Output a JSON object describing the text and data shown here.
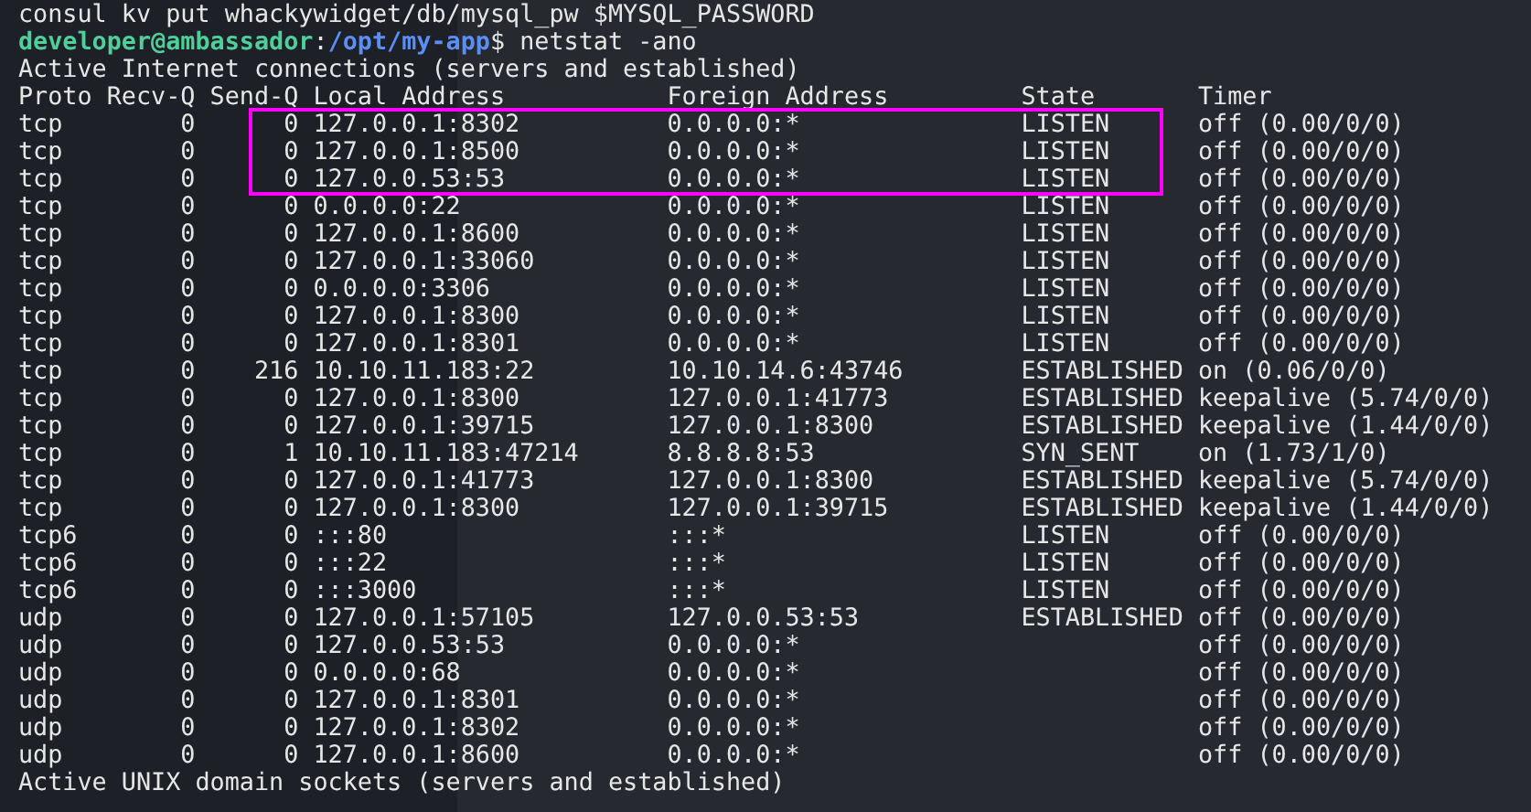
{
  "terminal": {
    "previous_command": "consul kv put whackywidget/db/mysql_pw $MYSQL_PASSWORD",
    "prompt": {
      "user_host": "developer@ambassador",
      "separator": ":",
      "path": "/opt/my-app",
      "symbol": "$",
      "command": "netstat -ano"
    },
    "section_title": "Active Internet connections (servers and established)",
    "table": [
      {
        "kind": "header",
        "highlighted": false,
        "cells": [
          "Proto",
          "Recv-Q",
          "Send-Q",
          "Local Address",
          "Foreign Address",
          "State",
          "Timer"
        ]
      },
      {
        "kind": "row",
        "highlighted": true,
        "cells": [
          "tcp",
          "0",
          "0",
          "127.0.0.1:8302",
          "0.0.0.0:*",
          "LISTEN",
          "off (0.00/0/0)"
        ]
      },
      {
        "kind": "row",
        "highlighted": true,
        "cells": [
          "tcp",
          "0",
          "0",
          "127.0.0.1:8500",
          "0.0.0.0:*",
          "LISTEN",
          "off (0.00/0/0)"
        ]
      },
      {
        "kind": "row",
        "highlighted": true,
        "cells": [
          "tcp",
          "0",
          "0",
          "127.0.0.53:53",
          "0.0.0.0:*",
          "LISTEN",
          "off (0.00/0/0)"
        ]
      },
      {
        "kind": "row",
        "highlighted": false,
        "cells": [
          "tcp",
          "0",
          "0",
          "0.0.0.0:22",
          "0.0.0.0:*",
          "LISTEN",
          "off (0.00/0/0)"
        ]
      },
      {
        "kind": "row",
        "highlighted": false,
        "cells": [
          "tcp",
          "0",
          "0",
          "127.0.0.1:8600",
          "0.0.0.0:*",
          "LISTEN",
          "off (0.00/0/0)"
        ]
      },
      {
        "kind": "row",
        "highlighted": false,
        "cells": [
          "tcp",
          "0",
          "0",
          "127.0.0.1:33060",
          "0.0.0.0:*",
          "LISTEN",
          "off (0.00/0/0)"
        ]
      },
      {
        "kind": "row",
        "highlighted": false,
        "cells": [
          "tcp",
          "0",
          "0",
          "0.0.0.0:3306",
          "0.0.0.0:*",
          "LISTEN",
          "off (0.00/0/0)"
        ]
      },
      {
        "kind": "row",
        "highlighted": false,
        "cells": [
          "tcp",
          "0",
          "0",
          "127.0.0.1:8300",
          "0.0.0.0:*",
          "LISTEN",
          "off (0.00/0/0)"
        ]
      },
      {
        "kind": "row",
        "highlighted": false,
        "cells": [
          "tcp",
          "0",
          "0",
          "127.0.0.1:8301",
          "0.0.0.0:*",
          "LISTEN",
          "off (0.00/0/0)"
        ]
      },
      {
        "kind": "row",
        "highlighted": false,
        "cells": [
          "tcp",
          "0",
          "216",
          "10.10.11.183:22",
          "10.10.14.6:43746",
          "ESTABLISHED",
          "on (0.06/0/0)"
        ]
      },
      {
        "kind": "row",
        "highlighted": false,
        "cells": [
          "tcp",
          "0",
          "0",
          "127.0.0.1:8300",
          "127.0.0.1:41773",
          "ESTABLISHED",
          "keepalive (5.74/0/0)"
        ]
      },
      {
        "kind": "row",
        "highlighted": false,
        "cells": [
          "tcp",
          "0",
          "0",
          "127.0.0.1:39715",
          "127.0.0.1:8300",
          "ESTABLISHED",
          "keepalive (1.44/0/0)"
        ]
      },
      {
        "kind": "row",
        "highlighted": false,
        "cells": [
          "tcp",
          "0",
          "1",
          "10.10.11.183:47214",
          "8.8.8.8:53",
          "SYN_SENT",
          "on (1.73/1/0)"
        ]
      },
      {
        "kind": "row",
        "highlighted": false,
        "cells": [
          "tcp",
          "0",
          "0",
          "127.0.0.1:41773",
          "127.0.0.1:8300",
          "ESTABLISHED",
          "keepalive (5.74/0/0)"
        ]
      },
      {
        "kind": "row",
        "highlighted": false,
        "cells": [
          "tcp",
          "0",
          "0",
          "127.0.0.1:8300",
          "127.0.0.1:39715",
          "ESTABLISHED",
          "keepalive (1.44/0/0)"
        ]
      },
      {
        "kind": "row",
        "highlighted": false,
        "cells": [
          "tcp6",
          "0",
          "0",
          ":::80",
          ":::*",
          "LISTEN",
          "off (0.00/0/0)"
        ]
      },
      {
        "kind": "row",
        "highlighted": false,
        "cells": [
          "tcp6",
          "0",
          "0",
          ":::22",
          ":::*",
          "LISTEN",
          "off (0.00/0/0)"
        ]
      },
      {
        "kind": "row",
        "highlighted": false,
        "cells": [
          "tcp6",
          "0",
          "0",
          ":::3000",
          ":::*",
          "LISTEN",
          "off (0.00/0/0)"
        ]
      },
      {
        "kind": "row",
        "highlighted": false,
        "cells": [
          "udp",
          "0",
          "0",
          "127.0.0.1:57105",
          "127.0.0.53:53",
          "ESTABLISHED",
          "off (0.00/0/0)"
        ]
      },
      {
        "kind": "row",
        "highlighted": false,
        "cells": [
          "udp",
          "0",
          "0",
          "127.0.0.53:53",
          "0.0.0.0:*",
          null,
          "off (0.00/0/0)"
        ]
      },
      {
        "kind": "row",
        "highlighted": false,
        "cells": [
          "udp",
          "0",
          "0",
          "0.0.0.0:68",
          "0.0.0.0:*",
          null,
          "off (0.00/0/0)"
        ]
      },
      {
        "kind": "row",
        "highlighted": false,
        "cells": [
          "udp",
          "0",
          "0",
          "127.0.0.1:8301",
          "0.0.0.0:*",
          null,
          "off (0.00/0/0)"
        ]
      },
      {
        "kind": "row",
        "highlighted": false,
        "cells": [
          "udp",
          "0",
          "0",
          "127.0.0.1:8302",
          "0.0.0.0:*",
          null,
          "off (0.00/0/0)"
        ]
      },
      {
        "kind": "row",
        "highlighted": false,
        "cells": [
          "udp",
          "0",
          "0",
          "127.0.0.1:8600",
          "0.0.0.0:*",
          null,
          "off (0.00/0/0)"
        ]
      }
    ],
    "next_section_title": "Active UNIX domain sockets (servers and established)"
  }
}
